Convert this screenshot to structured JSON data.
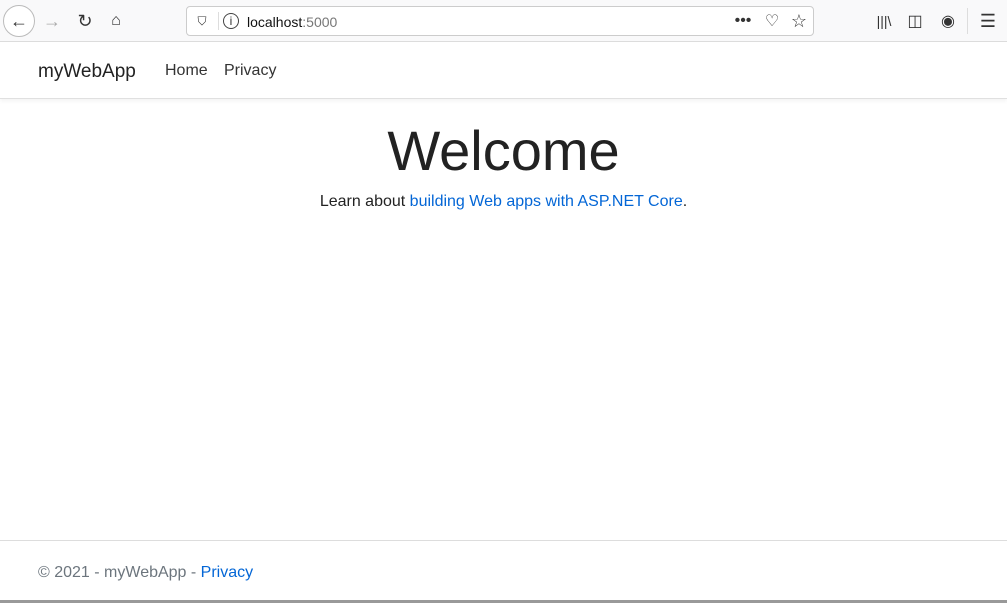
{
  "browser": {
    "url_host": "localhost",
    "url_port": ":5000"
  },
  "navbar": {
    "brand": "myWebApp",
    "links": [
      "Home",
      "Privacy"
    ]
  },
  "main": {
    "title": "Welcome",
    "lead_prefix": "Learn about ",
    "lead_link": "building Web apps with ASP.NET Core",
    "lead_suffix": "."
  },
  "footer": {
    "text": "© 2021 - myWebApp - ",
    "link": "Privacy"
  }
}
